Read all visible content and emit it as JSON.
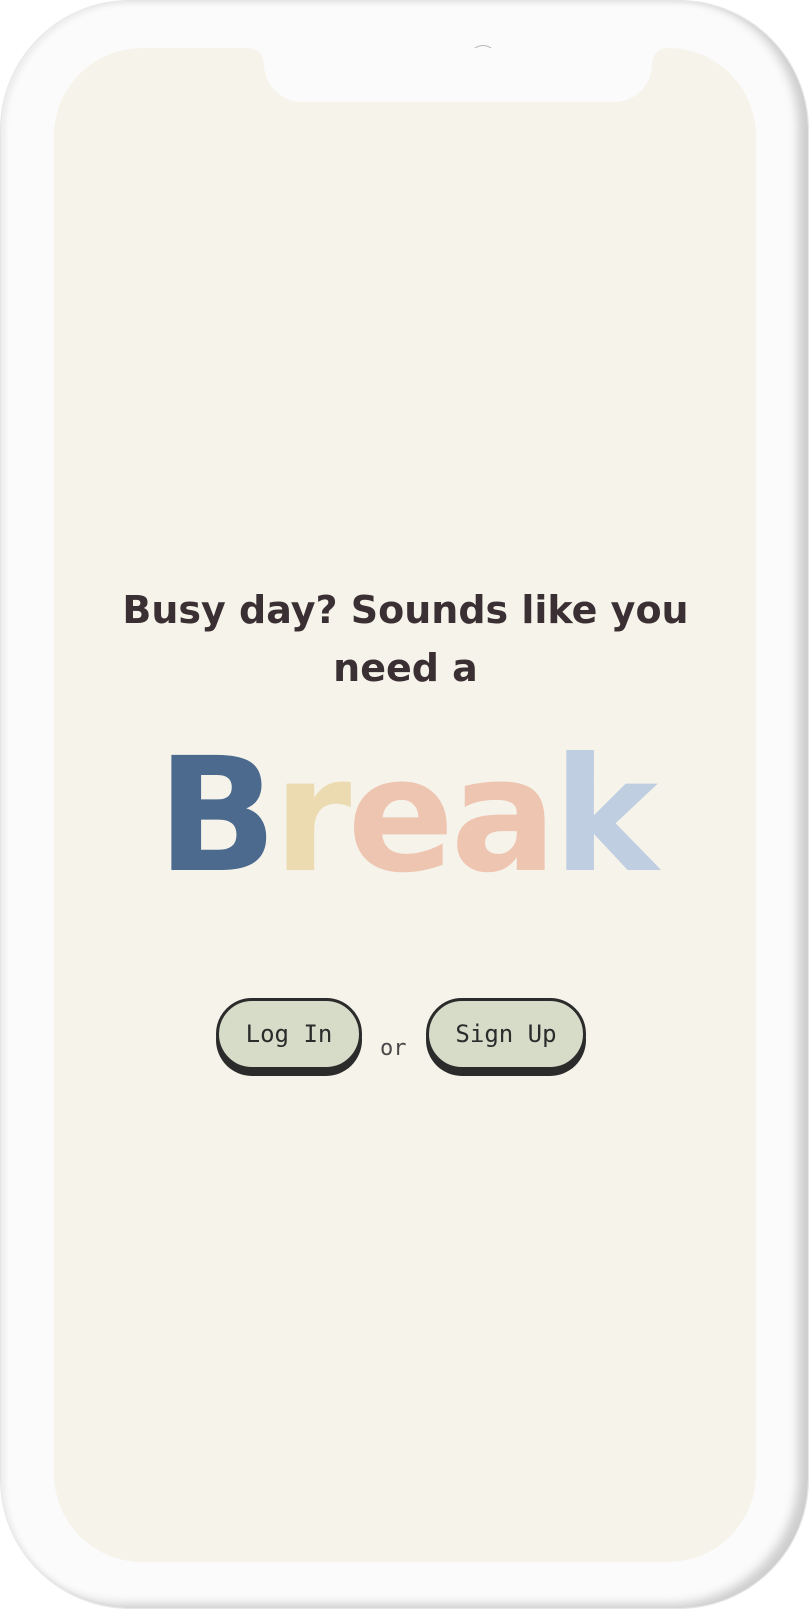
{
  "tagline": {
    "line1": "Busy day? Sounds like you",
    "line2": "need a"
  },
  "brand": {
    "letters": [
      "B",
      "r",
      "e",
      "a",
      "k"
    ],
    "colors": [
      "#4b6a8e",
      "#ecdbb0",
      "#eec5b0",
      "#eec5b0",
      "#bfcee1"
    ]
  },
  "actions": {
    "login_label": "Log In",
    "separator": "or",
    "signup_label": "Sign Up"
  }
}
